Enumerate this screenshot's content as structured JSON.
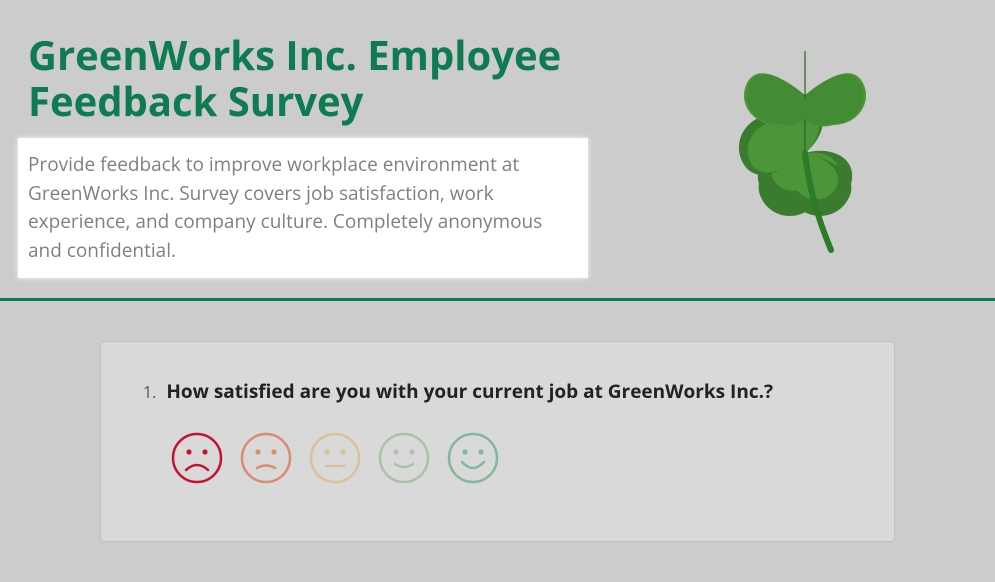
{
  "header": {
    "title": "GreenWorks Inc. Employee Feedback Survey",
    "description": "Provide feedback to improve workplace environment at GreenWorks Inc. Survey covers job satisfaction, work experience, and company culture. Completely anonymous and confidential."
  },
  "colors": {
    "brand": "#0f7b53",
    "smiley_very_dissatisfied": "#c8102e",
    "smiley_dissatisfied": "#d98d6f",
    "smiley_neutral": "#d9c19a",
    "smiley_satisfied": "#a8c4a8",
    "smiley_very_satisfied": "#7fb99a"
  },
  "question": {
    "number": "1.",
    "text": "How satisfied are you with your current job at GreenWorks Inc.?",
    "scale": [
      {
        "name": "very-dissatisfied",
        "label": "Very Dissatisfied"
      },
      {
        "name": "dissatisfied",
        "label": "Dissatisfied"
      },
      {
        "name": "neutral",
        "label": "Neutral"
      },
      {
        "name": "satisfied",
        "label": "Satisfied"
      },
      {
        "name": "very-satisfied",
        "label": "Very Satisfied"
      }
    ]
  }
}
